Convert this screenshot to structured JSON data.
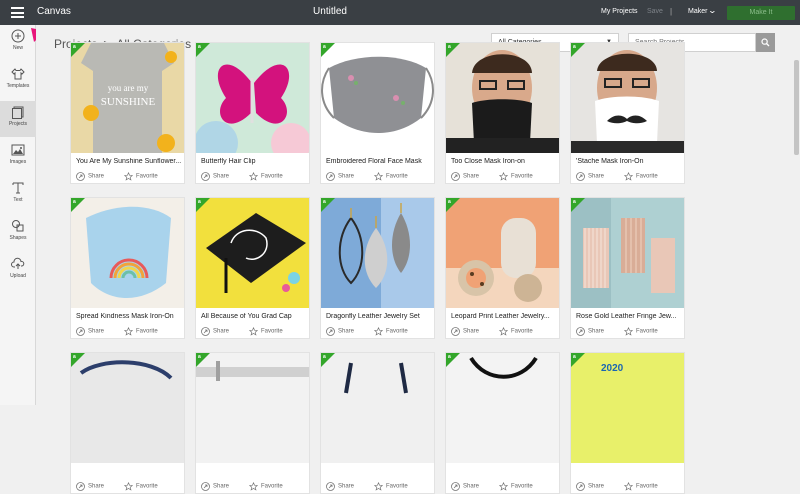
{
  "app": {
    "brand": "Canvas",
    "document_title": "Untitled",
    "my_projects": "My Projects",
    "save": "Save",
    "separator": "|",
    "machine": "Maker",
    "make_it": "Make It"
  },
  "sidebar": {
    "items": [
      {
        "label": "New",
        "icon": "plus-circle-icon"
      },
      {
        "label": "Templates",
        "icon": "shirt-icon"
      },
      {
        "label": "Projects",
        "icon": "projects-icon"
      },
      {
        "label": "Images",
        "icon": "image-icon"
      },
      {
        "label": "Text",
        "icon": "text-icon"
      },
      {
        "label": "Shapes",
        "icon": "shapes-icon"
      },
      {
        "label": "Upload",
        "icon": "upload-icon"
      }
    ]
  },
  "breadcrumb": {
    "root": "Projects",
    "separator": ">",
    "current": "All Categories"
  },
  "filter": {
    "selected": "All Categories",
    "search_placeholder": "Search Projects"
  },
  "actions": {
    "share": "Share",
    "favorite": "Favorite"
  },
  "colors": {
    "accent_green": "#33a62a",
    "topbar": "#3a3f44",
    "annotation_arrow": "#e8157a"
  },
  "projects": [
    {
      "title": "You Are My Sunshine Sunflower..."
    },
    {
      "title": "Butterfly Hair Clip"
    },
    {
      "title": "Embroidered Floral Face Mask"
    },
    {
      "title": "Too Close Mask Iron-on"
    },
    {
      "title": "'Stache Mask Iron-On"
    },
    {
      "title": "Spread Kindness Mask Iron-On"
    },
    {
      "title": "All Because of You Grad Cap"
    },
    {
      "title": "Dragonfly Leather Jewelry Set"
    },
    {
      "title": "Leopard Print Leather Jewelry..."
    },
    {
      "title": "Rose Gold Leather Fringe Jew..."
    },
    {
      "title": ""
    },
    {
      "title": ""
    },
    {
      "title": ""
    },
    {
      "title": ""
    },
    {
      "title": ""
    }
  ]
}
